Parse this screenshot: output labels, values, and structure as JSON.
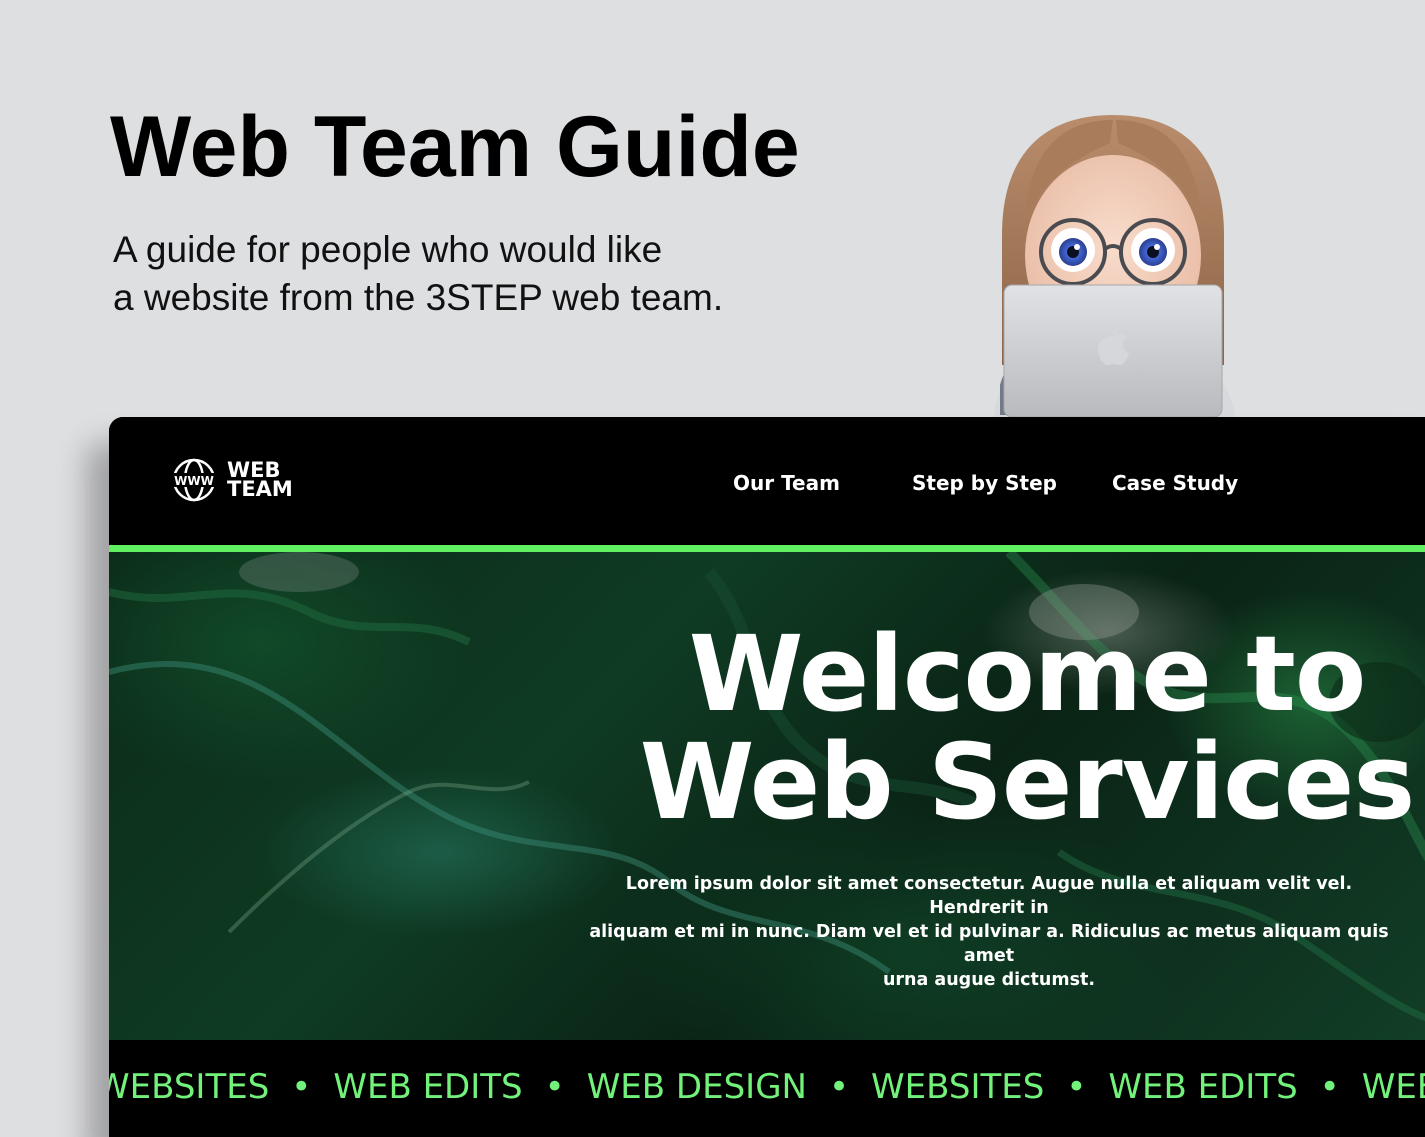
{
  "guide": {
    "title": "Web Team Guide",
    "subtitle_line1": "A guide for people who would like",
    "subtitle_line2": "a website from the 3STEP web team."
  },
  "site": {
    "logo": {
      "icon": "globe-www-icon",
      "line1": "WEB",
      "line2": "TEAM"
    },
    "nav": [
      {
        "label": "Our Team"
      },
      {
        "label": "Step by Step"
      },
      {
        "label": "Case Study"
      }
    ],
    "hero": {
      "title_line1": "Welcome to",
      "title_line2": "Web Services",
      "text_line1": "Lorem ipsum dolor sit amet consectetur. Augue nulla et aliquam velit vel. Hendrerit in",
      "text_line2": "aliquam et mi in nunc. Diam vel et id pulvinar a. Ridiculus ac metus aliquam quis amet",
      "text_line3": "urna augue dictumst."
    },
    "ticker": {
      "items": [
        "WEBSITES",
        "WEB EDITS",
        "WEB DESIGN",
        "WEBSITES",
        "WEB EDITS",
        "WEB DESIGN"
      ],
      "separator": "•"
    }
  },
  "colors": {
    "accent": "#5ef05e",
    "ticker_text": "#72f27a",
    "page_bg": "#dedfe1"
  }
}
